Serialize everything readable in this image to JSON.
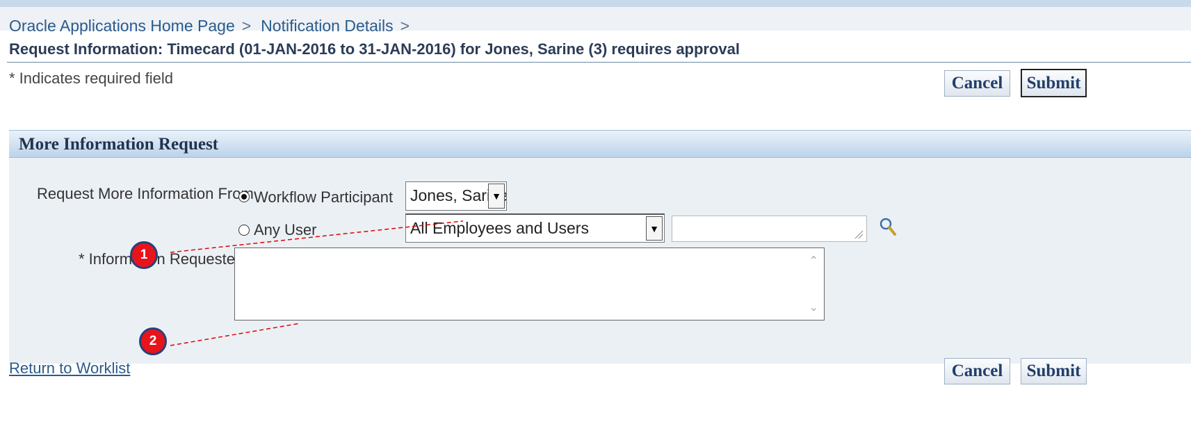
{
  "breadcrumbs": [
    "Oracle Applications Home Page",
    "Notification Details"
  ],
  "breadcrumb_separator": ">",
  "page_title": "Request Information: Timecard (01-JAN-2016 to 31-JAN-2016) for Jones, Sarine (3) requires approval",
  "required_note": "* Indicates required field",
  "buttons": {
    "cancel_label": "Cancel",
    "submit_label": "Submit"
  },
  "section": {
    "title": "More Information Request",
    "request_from_label": "Request More Information From",
    "options": [
      {
        "label": "Workflow Participant",
        "checked": true
      },
      {
        "label": "Any User",
        "checked": false
      }
    ],
    "participant_select": "Jones, Sarine",
    "user_scope_select": "All Employees and Users",
    "user_search_value": "",
    "info_requested_label": "* Information Requested",
    "info_requested_value": ""
  },
  "footer": {
    "return_link": "Return to Worklist"
  },
  "callouts": [
    "1",
    "2"
  ],
  "colors": {
    "link": "#2a5b8c",
    "title": "#2c3c57",
    "callout_fill": "#e8141c",
    "callout_ring": "#27407a",
    "section_bg": "#ebf0f5"
  },
  "icons": {
    "dropdown": "chevron-down-icon",
    "search": "magnifier-icon",
    "resize": "resize-grip-icon"
  }
}
